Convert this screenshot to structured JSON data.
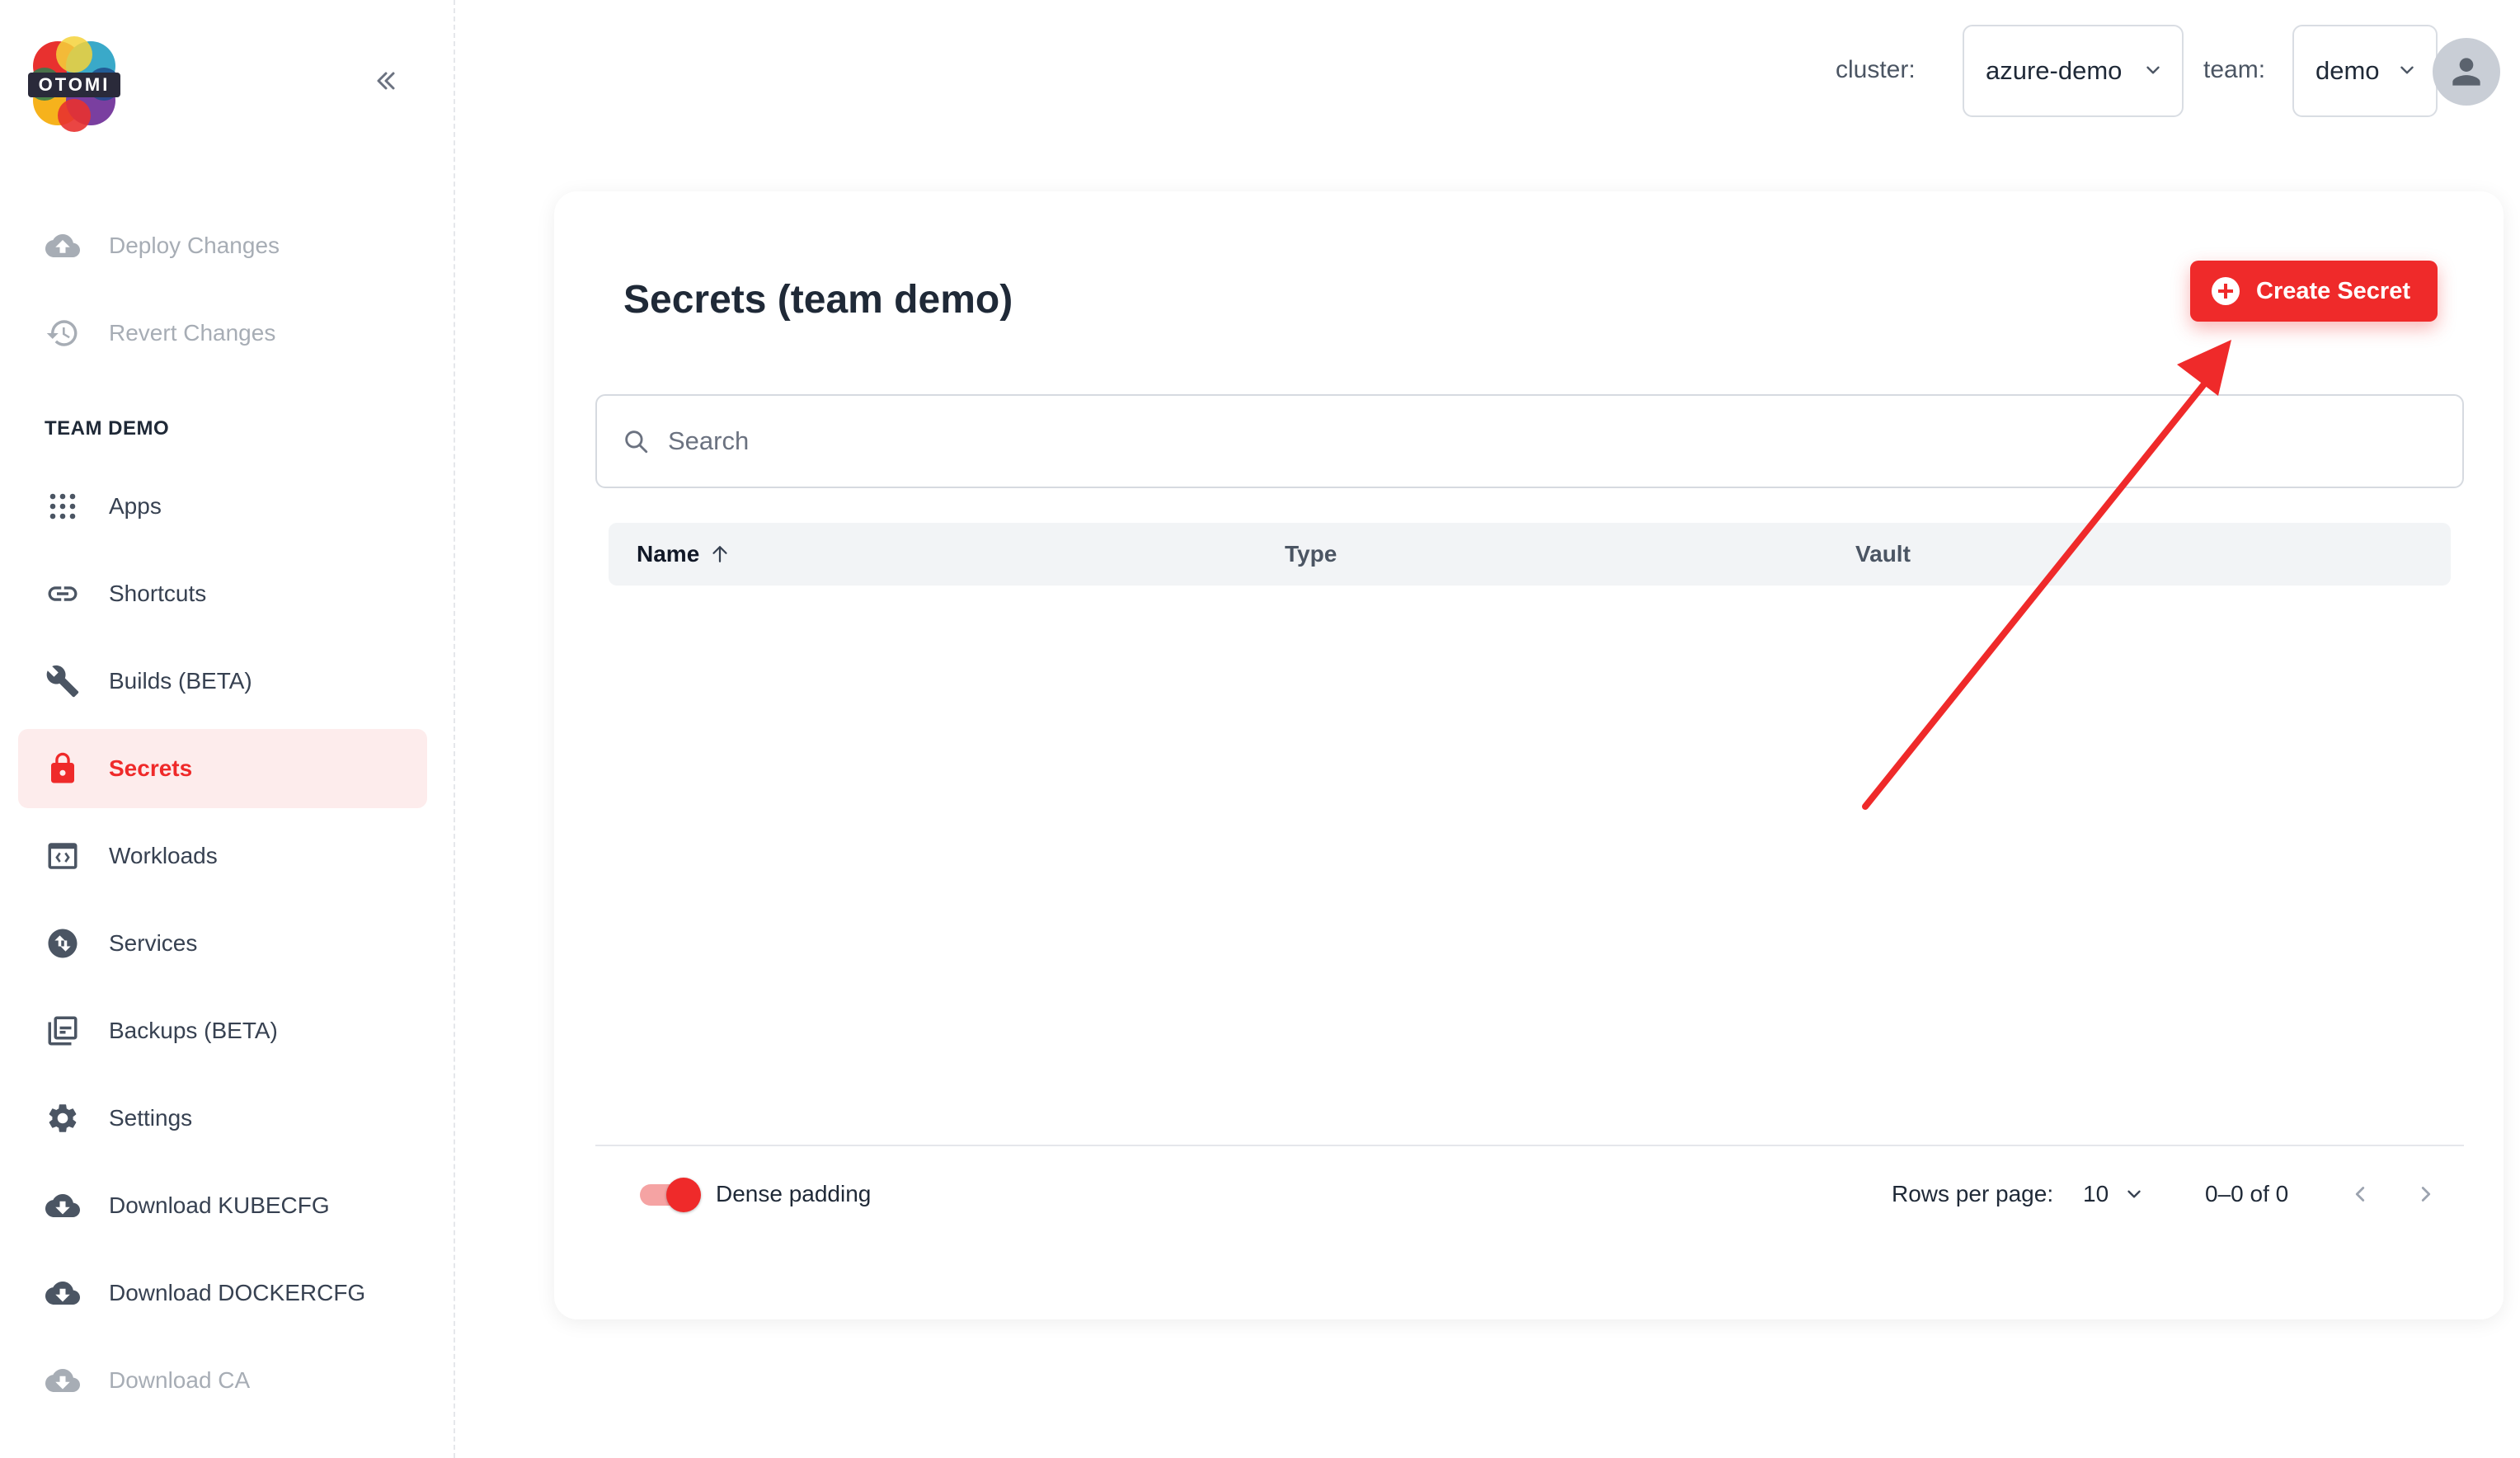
{
  "app": {
    "logo_text": "OTOMI"
  },
  "sidebar": {
    "top_items": [
      {
        "label": "Deploy Changes",
        "icon": "cloud-upload-icon"
      },
      {
        "label": "Revert Changes",
        "icon": "history-icon"
      }
    ],
    "section_title": "TEAM DEMO",
    "items": [
      {
        "label": "Apps",
        "icon": "apps-grid-icon"
      },
      {
        "label": "Shortcuts",
        "icon": "link-icon"
      },
      {
        "label": "Builds (BETA)",
        "icon": "wrench-icon"
      },
      {
        "label": "Secrets",
        "icon": "lock-icon",
        "active": true
      },
      {
        "label": "Workloads",
        "icon": "code-window-icon"
      },
      {
        "label": "Services",
        "icon": "swap-circle-icon"
      },
      {
        "label": "Backups (BETA)",
        "icon": "backup-icon"
      },
      {
        "label": "Settings",
        "icon": "gear-icon"
      },
      {
        "label": "Download KUBECFG",
        "icon": "cloud-download-icon"
      },
      {
        "label": "Download DOCKERCFG",
        "icon": "cloud-download-icon"
      },
      {
        "label": "Download CA",
        "icon": "cloud-download-icon"
      }
    ]
  },
  "header": {
    "cluster_label": "cluster:",
    "cluster_value": "azure-demo",
    "team_label": "team:",
    "team_value": "demo"
  },
  "main": {
    "title": "Secrets (team demo)",
    "create_button": "Create Secret",
    "search_placeholder": "Search",
    "columns": [
      "Name",
      "Type",
      "Vault"
    ],
    "rows": [],
    "footer": {
      "dense_label": "Dense padding",
      "dense_enabled": true,
      "rows_per_page_label": "Rows per page:",
      "rows_per_page_value": "10",
      "range": "0–0 of 0"
    }
  },
  "colors": {
    "accent": "#ef2a2a",
    "annotation_arrow": "#ef2a2a"
  }
}
